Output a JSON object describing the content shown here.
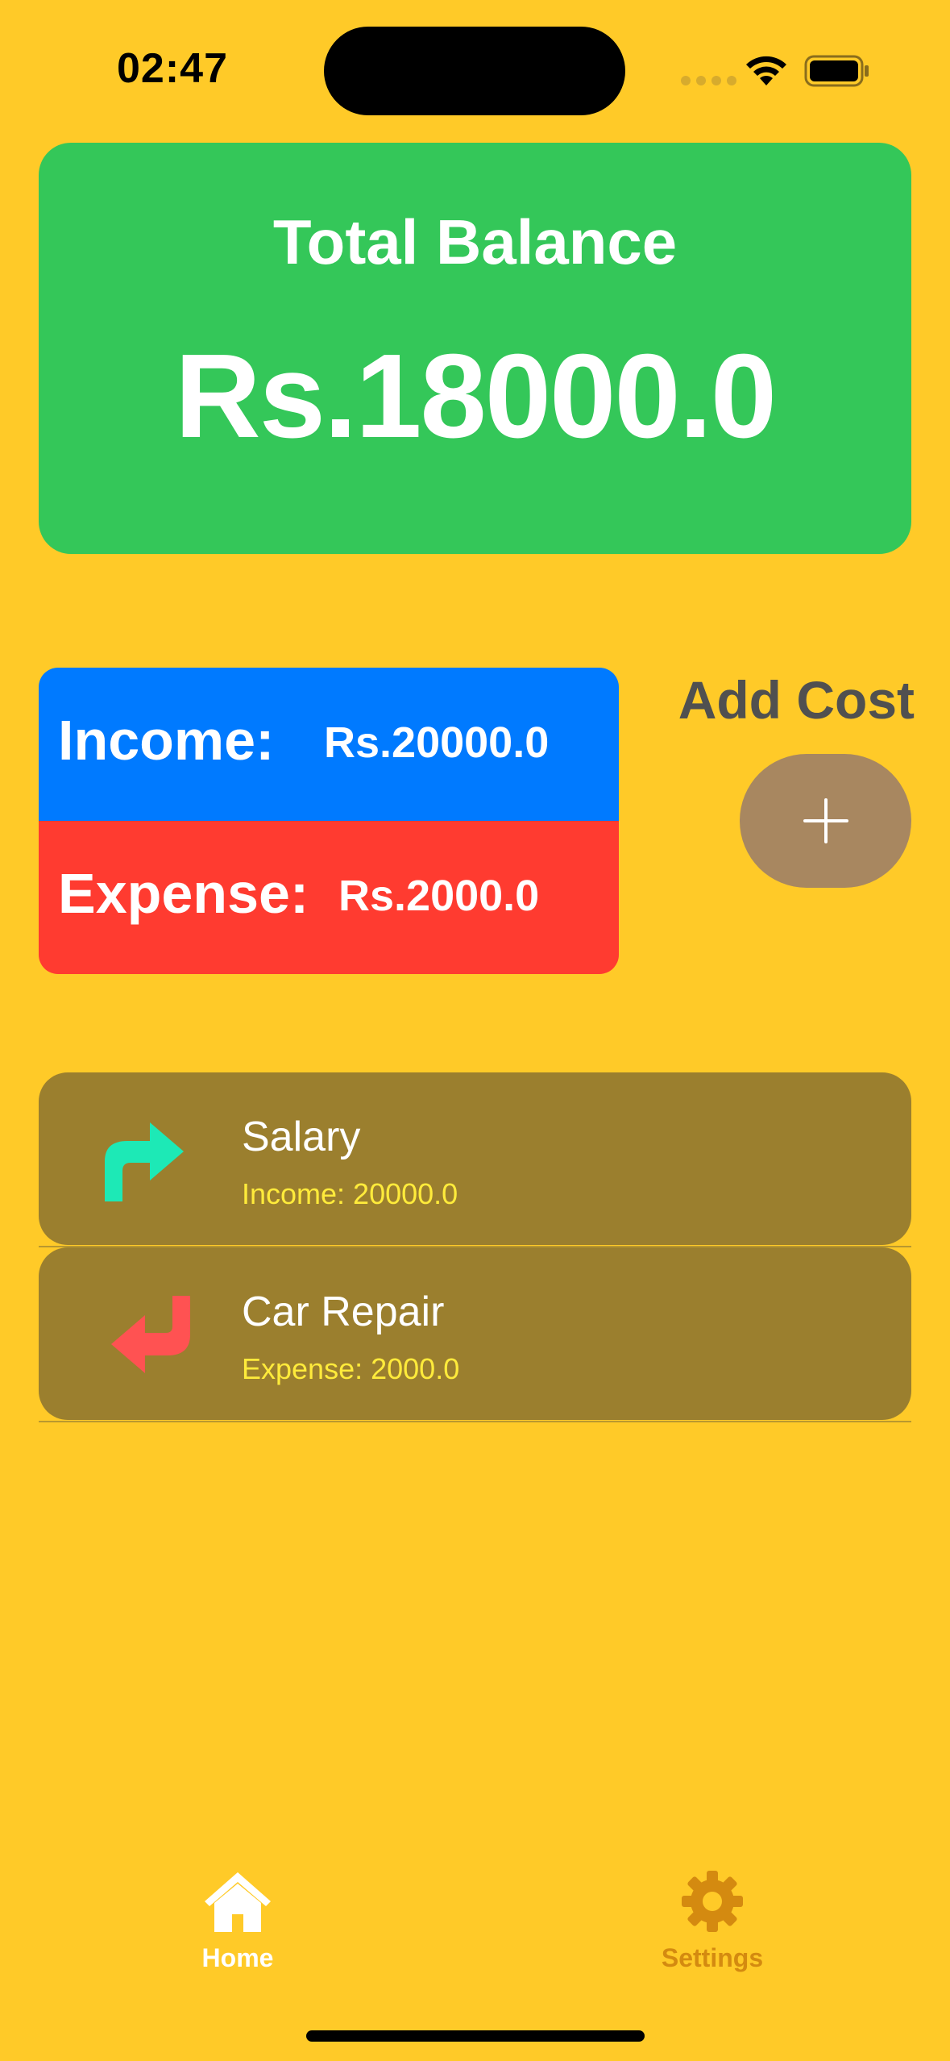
{
  "status_bar": {
    "time": "02:47"
  },
  "balance": {
    "title": "Total Balance",
    "amount": "Rs.18000.0"
  },
  "summary": {
    "income_label": "Income:",
    "income_value": "Rs.20000.0",
    "expense_label": "Expense:",
    "expense_value": "Rs.2000.0"
  },
  "add_cost": {
    "label": "Add Cost",
    "icon": "plus-icon"
  },
  "transactions": [
    {
      "title": "Salary",
      "subtitle": "Income: 20000.0",
      "icon": "arrow-turn-right-icon",
      "color": "#1DE9B6"
    },
    {
      "title": "Car Repair",
      "subtitle": "Expense: 2000.0",
      "icon": "arrow-turn-left-icon",
      "color": "#FF5252"
    }
  ],
  "tabs": [
    {
      "label": "Home",
      "icon": "house-icon",
      "active": true
    },
    {
      "label": "Settings",
      "icon": "gear-icon",
      "active": false
    }
  ],
  "colors": {
    "background": "#FFCA28",
    "balance_card": "#34C759",
    "income": "#007AFF",
    "expense": "#FF3B30",
    "transaction_card": "#9B7F2E",
    "add_button": "#A88760",
    "tab_active": "#FFFFFF",
    "tab_inactive": "#D48A10"
  }
}
